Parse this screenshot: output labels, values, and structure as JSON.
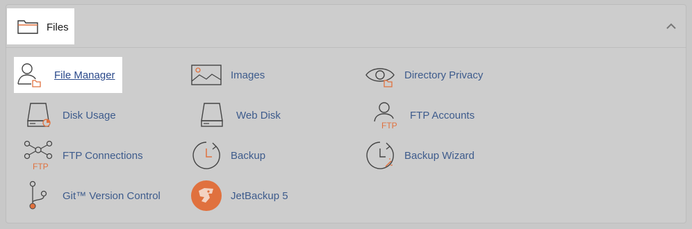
{
  "section": {
    "title": "Files",
    "title_icon": "folder-icon",
    "collapse_icon": "chevron-up-icon"
  },
  "items": [
    {
      "label": "File Manager",
      "icon": "file-manager-icon"
    },
    {
      "label": "Images",
      "icon": "images-icon"
    },
    {
      "label": "Directory Privacy",
      "icon": "directory-privacy-icon"
    },
    {
      "label": "Disk Usage",
      "icon": "disk-usage-icon"
    },
    {
      "label": "Web Disk",
      "icon": "web-disk-icon"
    },
    {
      "label": "FTP Accounts",
      "icon": "ftp-accounts-icon"
    },
    {
      "label": "FTP Connections",
      "icon": "ftp-connections-icon"
    },
    {
      "label": "Backup",
      "icon": "backup-icon"
    },
    {
      "label": "Backup Wizard",
      "icon": "backup-wizard-icon"
    },
    {
      "label": "Git™ Version Control",
      "icon": "git-icon"
    },
    {
      "label": "JetBackup 5",
      "icon": "jetbackup-icon"
    }
  ],
  "icon_text": {
    "ftp": "FTP"
  },
  "colors": {
    "accent": "#e0713e",
    "link": "#3d5b8c",
    "icon_stroke": "#444444"
  }
}
